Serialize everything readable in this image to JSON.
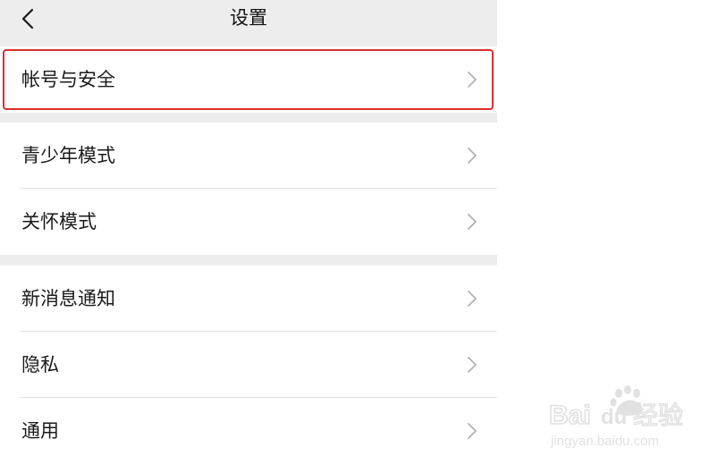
{
  "nav": {
    "title": "设置",
    "back_icon": "chevron-left-icon"
  },
  "groups": [
    {
      "items": [
        {
          "label": "帐号与安全",
          "highlighted": true
        }
      ]
    },
    {
      "items": [
        {
          "label": "青少年模式"
        },
        {
          "label": "关怀模式"
        }
      ]
    },
    {
      "items": [
        {
          "label": "新消息通知"
        },
        {
          "label": "隐私"
        },
        {
          "label": "通用"
        }
      ]
    }
  ],
  "row_icon": "chevron-right-icon",
  "watermark": {
    "brand": "Baidu经验",
    "url": "jingyan.baidu.com"
  },
  "colors": {
    "background": "#ededed",
    "row": "#ffffff",
    "highlight": "#d9302a",
    "chevron": "#b2b2b2"
  }
}
